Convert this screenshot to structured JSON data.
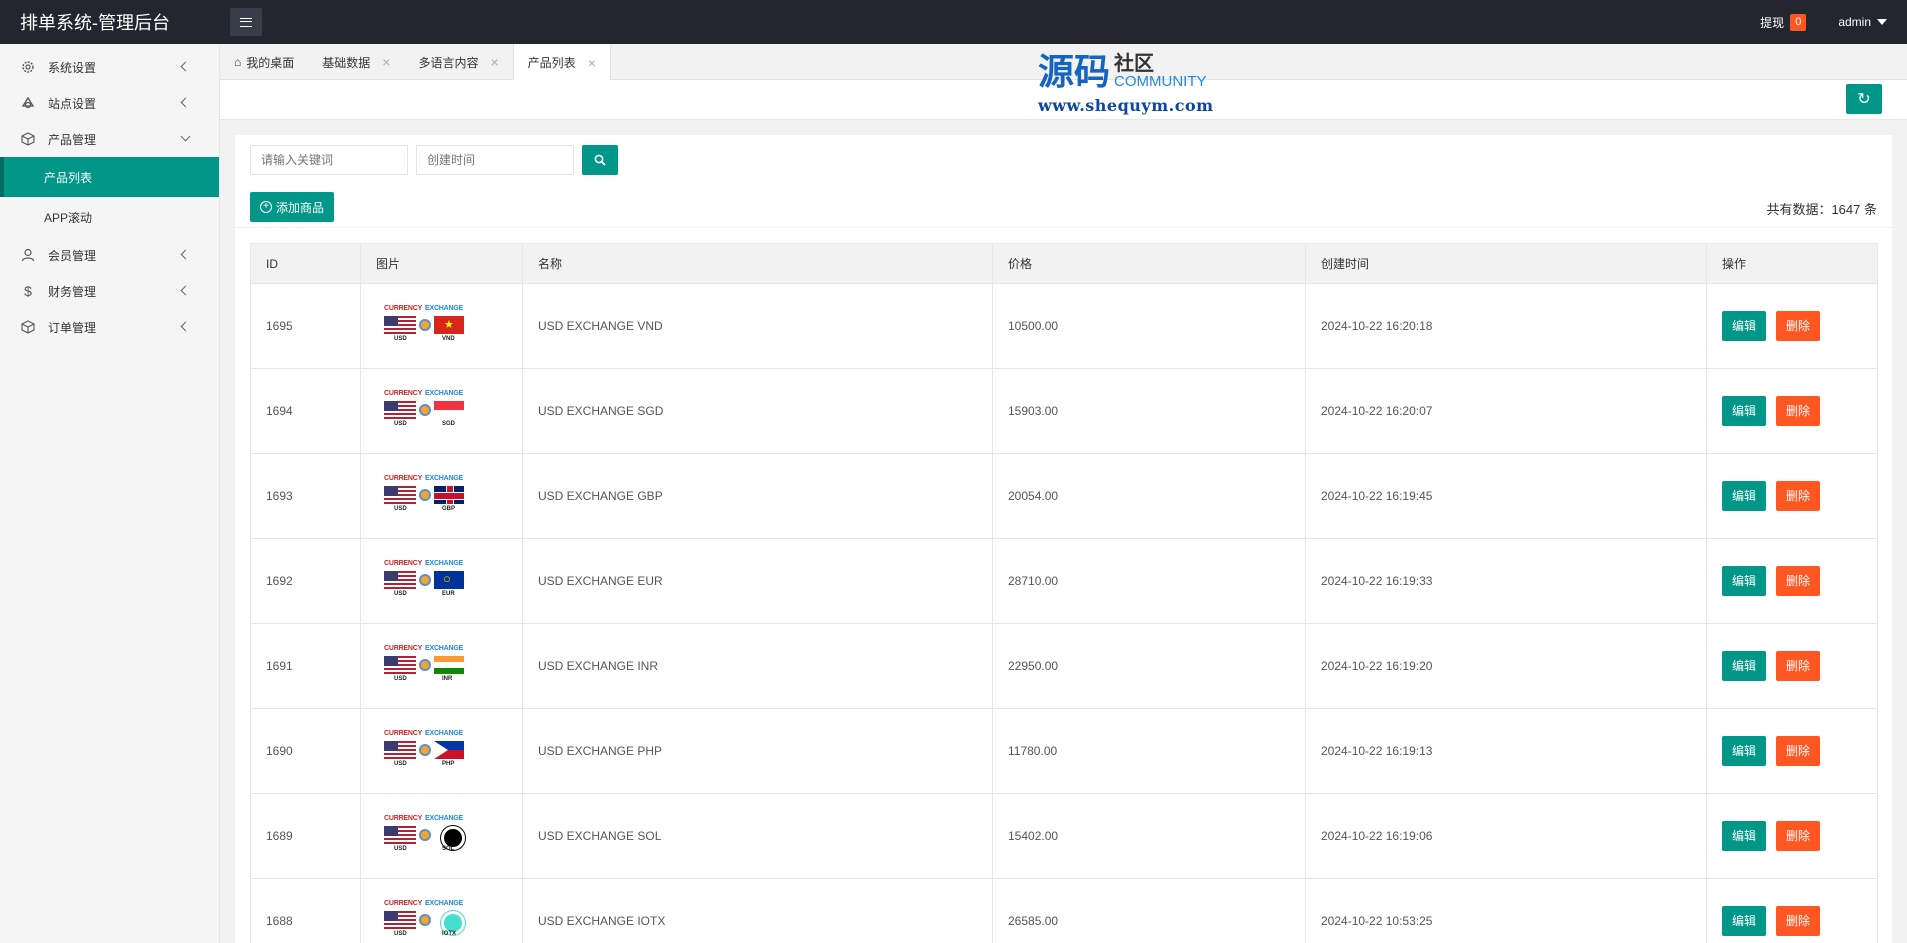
{
  "header": {
    "brand": "排单系统-管理后台",
    "withdraw_label": "提现",
    "withdraw_count": "0",
    "user_name": "admin"
  },
  "sidebar": {
    "items": [
      {
        "label": "系统设置",
        "icon": "gear-icon"
      },
      {
        "label": "站点设置",
        "icon": "site-icon"
      },
      {
        "label": "产品管理",
        "icon": "product-icon"
      },
      {
        "label": "会员管理",
        "icon": "user-icon"
      },
      {
        "label": "财务管理",
        "icon": "dollar-icon"
      },
      {
        "label": "订单管理",
        "icon": "order-icon"
      }
    ],
    "product_sub": [
      "产品列表",
      "APP滚动"
    ]
  },
  "tabs": [
    {
      "label": "我的桌面"
    },
    {
      "label": "基础数据"
    },
    {
      "label": "多语言内容"
    },
    {
      "label": "产品列表"
    }
  ],
  "watermark": {
    "big": "源码",
    "cn": "社区",
    "en": "COMMUNITY",
    "url": "www.shequym.com"
  },
  "search": {
    "keyword_placeholder": "请输入关键词",
    "time_placeholder": "创建时间"
  },
  "toolbar": {
    "add_label": "添加商品",
    "total_label": "共有数据：1647 条"
  },
  "table": {
    "columns": [
      "ID",
      "图片",
      "名称",
      "价格",
      "创建时间",
      "操作"
    ],
    "edit_label": "编辑",
    "delete_label": "删除",
    "thumb_top_left": "CURRENCY",
    "thumb_top_right": "EXCHANGE",
    "thumb_base": "USD",
    "rows": [
      {
        "id": "1695",
        "code": "VND",
        "name": "USD EXCHANGE VND",
        "price": "10500.00",
        "time": "2024-10-22 16:20:18"
      },
      {
        "id": "1694",
        "code": "SGD",
        "name": "USD EXCHANGE SGD",
        "price": "15903.00",
        "time": "2024-10-22 16:20:07"
      },
      {
        "id": "1693",
        "code": "GBP",
        "name": "USD EXCHANGE GBP",
        "price": "20054.00",
        "time": "2024-10-22 16:19:45"
      },
      {
        "id": "1692",
        "code": "EUR",
        "name": "USD EXCHANGE EUR",
        "price": "28710.00",
        "time": "2024-10-22 16:19:33"
      },
      {
        "id": "1691",
        "code": "INR",
        "name": "USD EXCHANGE INR",
        "price": "22950.00",
        "time": "2024-10-22 16:19:20"
      },
      {
        "id": "1690",
        "code": "PHP",
        "name": "USD EXCHANGE PHP",
        "price": "11780.00",
        "time": "2024-10-22 16:19:13"
      },
      {
        "id": "1689",
        "code": "SOL",
        "name": "USD EXCHANGE SOL",
        "price": "15402.00",
        "time": "2024-10-22 16:19:06"
      },
      {
        "id": "1688",
        "code": "IOTX",
        "name": "USD EXCHANGE IOTX",
        "price": "26585.00",
        "time": "2024-10-22 10:53:25"
      }
    ]
  },
  "colors": {
    "primary": "#009688",
    "danger": "#ff5722",
    "header_bg": "#23262e"
  }
}
